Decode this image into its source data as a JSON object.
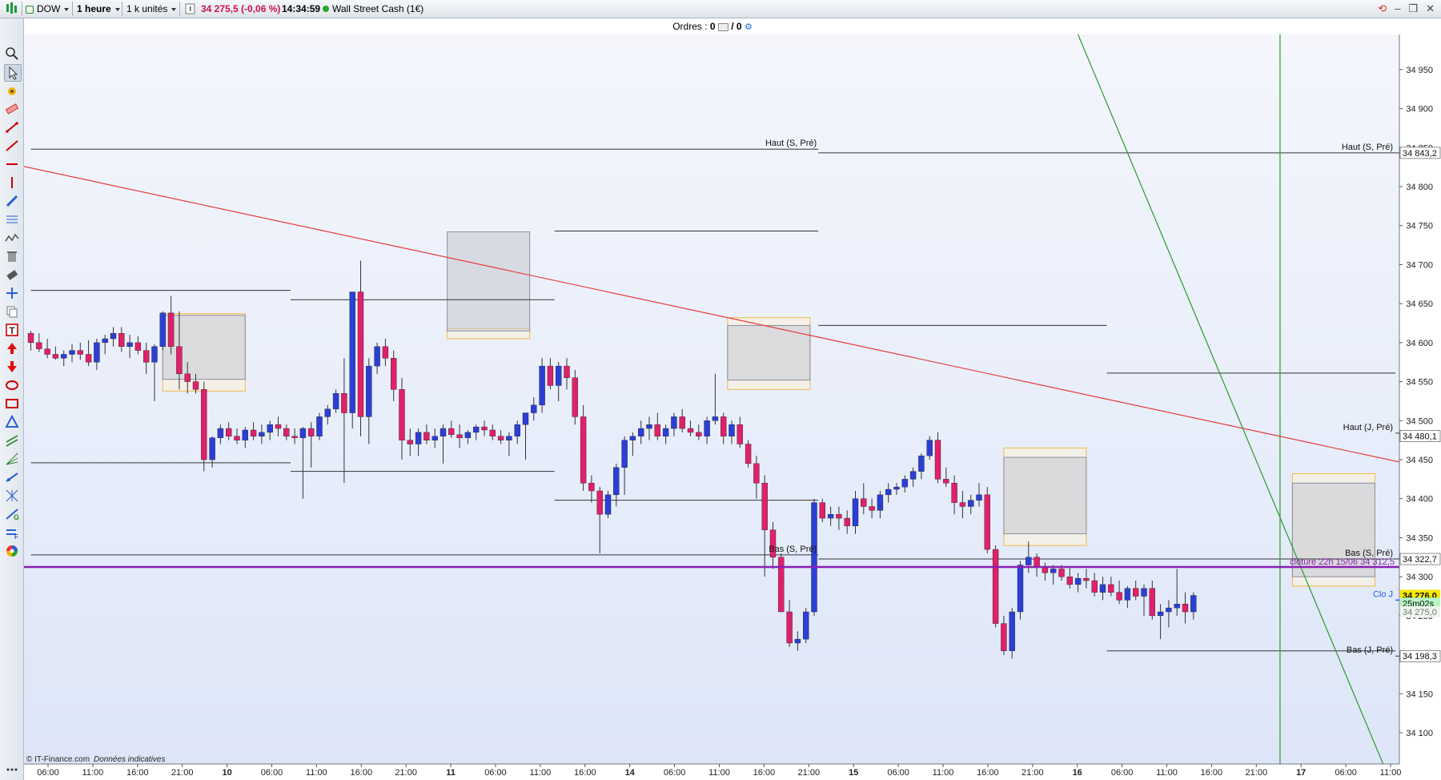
{
  "toolbar": {
    "symbol": "DOW",
    "timeframe": "1 heure",
    "units": "1 k unités",
    "price_change": "34 275,5 (-0,06 %)",
    "time": "14:34:59",
    "instrument": "Wall Street Cash (1€)"
  },
  "orders": {
    "label": "Ordres :",
    "count1": "0",
    "count2": "/ 0"
  },
  "footer": {
    "source": "© IT-Finance.com",
    "disclaimer": "Données indicatives"
  },
  "colors": {
    "up": "#2b3fd6",
    "down": "#e0206a",
    "trendline": "#e53c3c",
    "green_line": "#2a9a2a",
    "purple_line": "#8a1fb5",
    "blue_line": "#1e5ef0",
    "bg_top": "#f4f6fc",
    "bg_bottom": "#dde6f8"
  },
  "chart_data": {
    "type": "candlestick",
    "instrument": "DOW",
    "timeframe": "1 heure",
    "y_axis": {
      "ylim": [
        34060,
        34995
      ],
      "ticks": [
        34100,
        34150,
        34250,
        34300,
        34350,
        34400,
        34450,
        34500,
        34550,
        34600,
        34650,
        34700,
        34750,
        34800,
        34850,
        34900,
        34950
      ],
      "tick_labels": [
        "34 100",
        "34 150",
        "34 250",
        "34 300",
        "34 350",
        "34 400",
        "34 450",
        "34 500",
        "34 550",
        "34 600",
        "34 650",
        "34 700",
        "34 750",
        "34 800",
        "34 850",
        "34 900",
        "34 950"
      ],
      "price_tags": [
        {
          "value": 34843.2,
          "label": "34 843,2",
          "style": "plain"
        },
        {
          "value": 34480.1,
          "label": "34 480,1",
          "style": "plain"
        },
        {
          "value": 34322.7,
          "label": "34 322,7",
          "style": "plain"
        },
        {
          "value": 34276.0,
          "label": "34 276,0",
          "style": "current"
        },
        {
          "value": 34266.0,
          "label": "25m02s",
          "style": "timer"
        },
        {
          "value": 34255.0,
          "label": "34 275,0",
          "style": "faint"
        },
        {
          "value": 34198.3,
          "label": "34 198,3",
          "style": "plain"
        }
      ]
    },
    "x_axis": {
      "tick_labels": [
        "06:00",
        "11:00",
        "16:00",
        "21:00",
        "10",
        "06:00",
        "11:00",
        "16:00",
        "21:00",
        "11",
        "06:00",
        "11:00",
        "16:00",
        "14",
        "06:00",
        "11:00",
        "16:00",
        "21:00",
        "15",
        "06:00",
        "11:00",
        "16:00",
        "21:00",
        "16",
        "06:00",
        "11:00",
        "16:00",
        "21:00",
        "17",
        "06:00",
        "11:00"
      ],
      "bold_labels": [
        "10",
        "11",
        "14",
        "15",
        "16",
        "17"
      ]
    },
    "candles": [
      [
        34612,
        34615,
        34590,
        34600
      ],
      [
        34600,
        34612,
        34588,
        34592
      ],
      [
        34592,
        34605,
        34580,
        34585
      ],
      [
        34585,
        34595,
        34578,
        34580
      ],
      [
        34580,
        34590,
        34570,
        34585
      ],
      [
        34585,
        34598,
        34575,
        34590
      ],
      [
        34590,
        34600,
        34578,
        34585
      ],
      [
        34585,
        34603,
        34570,
        34575
      ],
      [
        34575,
        34605,
        34565,
        34600
      ],
      [
        34600,
        34610,
        34585,
        34605
      ],
      [
        34605,
        34620,
        34595,
        34612
      ],
      [
        34612,
        34620,
        34588,
        34595
      ],
      [
        34595,
        34610,
        34580,
        34600
      ],
      [
        34600,
        34608,
        34585,
        34590
      ],
      [
        34590,
        34600,
        34560,
        34575
      ],
      [
        34575,
        34598,
        34525,
        34595
      ],
      [
        34595,
        34640,
        34590,
        34638
      ],
      [
        34638,
        34660,
        34585,
        34595
      ],
      [
        34595,
        34640,
        34540,
        34560
      ],
      [
        34560,
        34575,
        34535,
        34550
      ],
      [
        34550,
        34560,
        34535,
        34540
      ],
      [
        34540,
        34550,
        34435,
        34450
      ],
      [
        34450,
        34480,
        34440,
        34478
      ],
      [
        34478,
        34495,
        34470,
        34490
      ],
      [
        34490,
        34498,
        34475,
        34480
      ],
      [
        34480,
        34490,
        34470,
        34475
      ],
      [
        34475,
        34492,
        34465,
        34488
      ],
      [
        34488,
        34498,
        34475,
        34480
      ],
      [
        34480,
        34495,
        34470,
        34485
      ],
      [
        34485,
        34500,
        34475,
        34495
      ],
      [
        34495,
        34505,
        34480,
        34490
      ],
      [
        34490,
        34495,
        34475,
        34480
      ],
      [
        34480,
        34490,
        34470,
        34478
      ],
      [
        34478,
        34492,
        34400,
        34490
      ],
      [
        34490,
        34498,
        34440,
        34480
      ],
      [
        34480,
        34510,
        34475,
        34505
      ],
      [
        34505,
        34520,
        34495,
        34515
      ],
      [
        34515,
        34540,
        34510,
        34535
      ],
      [
        34535,
        34580,
        34420,
        34510
      ],
      [
        34510,
        34665,
        34490,
        34665
      ],
      [
        34665,
        34705,
        34480,
        34505
      ],
      [
        34505,
        34580,
        34470,
        34570
      ],
      [
        34570,
        34600,
        34560,
        34595
      ],
      [
        34595,
        34605,
        34570,
        34580
      ],
      [
        34580,
        34590,
        34525,
        34540
      ],
      [
        34540,
        34555,
        34450,
        34475
      ],
      [
        34475,
        34490,
        34455,
        34470
      ],
      [
        34470,
        34490,
        34455,
        34485
      ],
      [
        34485,
        34495,
        34470,
        34475
      ],
      [
        34475,
        34490,
        34465,
        34480
      ],
      [
        34480,
        34495,
        34445,
        34490
      ],
      [
        34490,
        34500,
        34478,
        34482
      ],
      [
        34482,
        34495,
        34465,
        34478
      ],
      [
        34478,
        34488,
        34470,
        34485
      ],
      [
        34485,
        34495,
        34475,
        34492
      ],
      [
        34492,
        34500,
        34480,
        34488
      ],
      [
        34488,
        34495,
        34475,
        34480
      ],
      [
        34480,
        34488,
        34470,
        34475
      ],
      [
        34475,
        34485,
        34455,
        34480
      ],
      [
        34480,
        34500,
        34470,
        34495
      ],
      [
        34495,
        34510,
        34450,
        34510
      ],
      [
        34510,
        34530,
        34500,
        34520
      ],
      [
        34520,
        34580,
        34510,
        34570
      ],
      [
        34570,
        34580,
        34540,
        34545
      ],
      [
        34545,
        34575,
        34525,
        34570
      ],
      [
        34570,
        34580,
        34540,
        34555
      ],
      [
        34555,
        34565,
        34495,
        34505
      ],
      [
        34505,
        34520,
        34410,
        34420
      ],
      [
        34420,
        34430,
        34395,
        34410
      ],
      [
        34410,
        34415,
        34330,
        34380
      ],
      [
        34380,
        34410,
        34375,
        34405
      ],
      [
        34405,
        34445,
        34390,
        34440
      ],
      [
        34440,
        34480,
        34405,
        34475
      ],
      [
        34475,
        34485,
        34455,
        34480
      ],
      [
        34480,
        34500,
        34470,
        34490
      ],
      [
        34490,
        34505,
        34475,
        34495
      ],
      [
        34495,
        34510,
        34475,
        34480
      ],
      [
        34480,
        34495,
        34470,
        34490
      ],
      [
        34490,
        34510,
        34480,
        34505
      ],
      [
        34505,
        34515,
        34485,
        34490
      ],
      [
        34490,
        34500,
        34480,
        34485
      ],
      [
        34485,
        34495,
        34475,
        34480
      ],
      [
        34480,
        34505,
        34470,
        34500
      ],
      [
        34500,
        34560,
        34495,
        34505
      ],
      [
        34505,
        34510,
        34470,
        34480
      ],
      [
        34480,
        34500,
        34470,
        34495
      ],
      [
        34495,
        34505,
        34465,
        34470
      ],
      [
        34470,
        34475,
        34440,
        34445
      ],
      [
        34445,
        34455,
        34400,
        34420
      ],
      [
        34420,
        34430,
        34300,
        34360
      ],
      [
        34360,
        34370,
        34310,
        34325
      ],
      [
        34325,
        34330,
        34260,
        34255
      ],
      [
        34255,
        34270,
        34210,
        34215
      ],
      [
        34215,
        34230,
        34205,
        34220
      ],
      [
        34220,
        34260,
        34215,
        34255
      ],
      [
        34255,
        34400,
        34250,
        34395
      ],
      [
        34395,
        34400,
        34370,
        34375
      ],
      [
        34375,
        34390,
        34365,
        34380
      ],
      [
        34380,
        34390,
        34360,
        34375
      ],
      [
        34375,
        34385,
        34355,
        34365
      ],
      [
        34365,
        34410,
        34355,
        34400
      ],
      [
        34400,
        34420,
        34380,
        34390
      ],
      [
        34390,
        34400,
        34375,
        34385
      ],
      [
        34385,
        34410,
        34375,
        34405
      ],
      [
        34405,
        34420,
        34395,
        34412
      ],
      [
        34412,
        34420,
        34405,
        34415
      ],
      [
        34415,
        34430,
        34408,
        34425
      ],
      [
        34425,
        34440,
        34415,
        34435
      ],
      [
        34435,
        34458,
        34425,
        34455
      ],
      [
        34455,
        34480,
        34450,
        34475
      ],
      [
        34475,
        34485,
        34420,
        34425
      ],
      [
        34425,
        34440,
        34415,
        34420
      ],
      [
        34420,
        34430,
        34380,
        34395
      ],
      [
        34395,
        34410,
        34375,
        34390
      ],
      [
        34390,
        34405,
        34380,
        34398
      ],
      [
        34398,
        34420,
        34390,
        34405
      ],
      [
        34405,
        34415,
        34330,
        34335
      ],
      [
        34335,
        34340,
        34235,
        34240
      ],
      [
        34240,
        34250,
        34200,
        34205
      ],
      [
        34205,
        34260,
        34195,
        34255
      ],
      [
        34255,
        34320,
        34245,
        34315
      ],
      [
        34315,
        34345,
        34305,
        34325
      ],
      [
        34325,
        34330,
        34300,
        34312
      ],
      [
        34312,
        34318,
        34295,
        34305
      ],
      [
        34305,
        34315,
        34290,
        34310
      ],
      [
        34310,
        34315,
        34295,
        34300
      ],
      [
        34300,
        34312,
        34285,
        34290
      ],
      [
        34290,
        34305,
        34280,
        34298
      ],
      [
        34298,
        34310,
        34285,
        34295
      ],
      [
        34295,
        34305,
        34275,
        34280
      ],
      [
        34280,
        34300,
        34270,
        34290
      ],
      [
        34290,
        34300,
        34275,
        34280
      ],
      [
        34280,
        34295,
        34265,
        34270
      ],
      [
        34270,
        34288,
        34260,
        34285
      ],
      [
        34285,
        34295,
        34270,
        34275
      ],
      [
        34275,
        34290,
        34250,
        34285
      ],
      [
        34285,
        34295,
        34245,
        34250
      ],
      [
        34250,
        34265,
        34220,
        34255
      ],
      [
        34255,
        34270,
        34235,
        34260
      ],
      [
        34260,
        34310,
        34250,
        34265
      ],
      [
        34265,
        34280,
        34240,
        34255
      ],
      [
        34255,
        34280,
        34245,
        34276
      ]
    ],
    "horizontal_segments": [
      {
        "value": 34848,
        "from": 0,
        "to": 95.5,
        "label": "Haut (S, Pré)",
        "label_at": 95.5
      },
      {
        "value": 34843.2,
        "from": 95.5,
        "to": 218,
        "label": "Haut (S, Pré)",
        "label_at": 218
      },
      {
        "value": 34743,
        "from": 63.5,
        "to": 95.5
      },
      {
        "value": 34667,
        "from": 0,
        "to": 31.5
      },
      {
        "value": 34655,
        "from": 31.5,
        "to": 63.5
      },
      {
        "value": 34622,
        "from": 95.5,
        "to": 130.5
      },
      {
        "value": 34561,
        "from": 130.5,
        "to": 165.5
      },
      {
        "value": 34484,
        "from": 165.5,
        "to": 202.5,
        "label": "Haut (J, Pré)",
        "label_at": 202.5
      },
      {
        "value": 34446,
        "from": 0,
        "to": 31.5
      },
      {
        "value": 34435,
        "from": 31.5,
        "to": 63.5
      },
      {
        "value": 34398,
        "from": 63.5,
        "to": 95.5
      },
      {
        "value": 34328,
        "from": 0,
        "to": 95.5,
        "label": "Bas (S, Pré)",
        "label_at": 95.5
      },
      {
        "value": 34322.7,
        "from": 95.5,
        "to": 218,
        "label": "Bas (S, Pré)",
        "label_at": 218
      },
      {
        "value": 34270,
        "from": 165.5,
        "to": 202.5,
        "label": "Clo J",
        "label_at": 202.5
      },
      {
        "value": 34205,
        "from": 130.5,
        "to": 165.5
      },
      {
        "value": 34198.3,
        "from": 165.5,
        "to": 202.5,
        "label": "Bas (J, Pré)",
        "label_at": 202.5
      }
    ],
    "purple_line": {
      "value": 34312.5,
      "label": "clôture 22h 15/06 34 312,5"
    },
    "trendlines": [
      {
        "color": "red",
        "from": [
          -4,
          34833
        ],
        "to": [
          225,
          34313
        ]
      },
      {
        "color": "green",
        "from": [
          127,
          34995
        ],
        "to": [
          164,
          34060
        ]
      }
    ],
    "vertical_line": {
      "at": 151.5,
      "color": "green"
    },
    "zones": [
      {
        "from": 16,
        "to": 26,
        "top": 34635,
        "bottom": 34553,
        "orange_top": 34637,
        "orange_bottom": 34538
      },
      {
        "from": 50.5,
        "to": 60.5,
        "top": 34742,
        "bottom": 34615,
        "orange_top": 34618,
        "orange_bottom": 34605
      },
      {
        "from": 84.5,
        "to": 94.5,
        "top": 34622,
        "bottom": 34552,
        "orange_top": 34632,
        "orange_bottom": 34540
      },
      {
        "from": 118,
        "to": 128,
        "top": 34453,
        "bottom": 34355,
        "orange_top": 34465,
        "orange_bottom": 34340
      },
      {
        "from": 153,
        "to": 163,
        "top": 34420,
        "bottom": 34300,
        "orange_top": 34432,
        "orange_bottom": 34288
      }
    ]
  }
}
